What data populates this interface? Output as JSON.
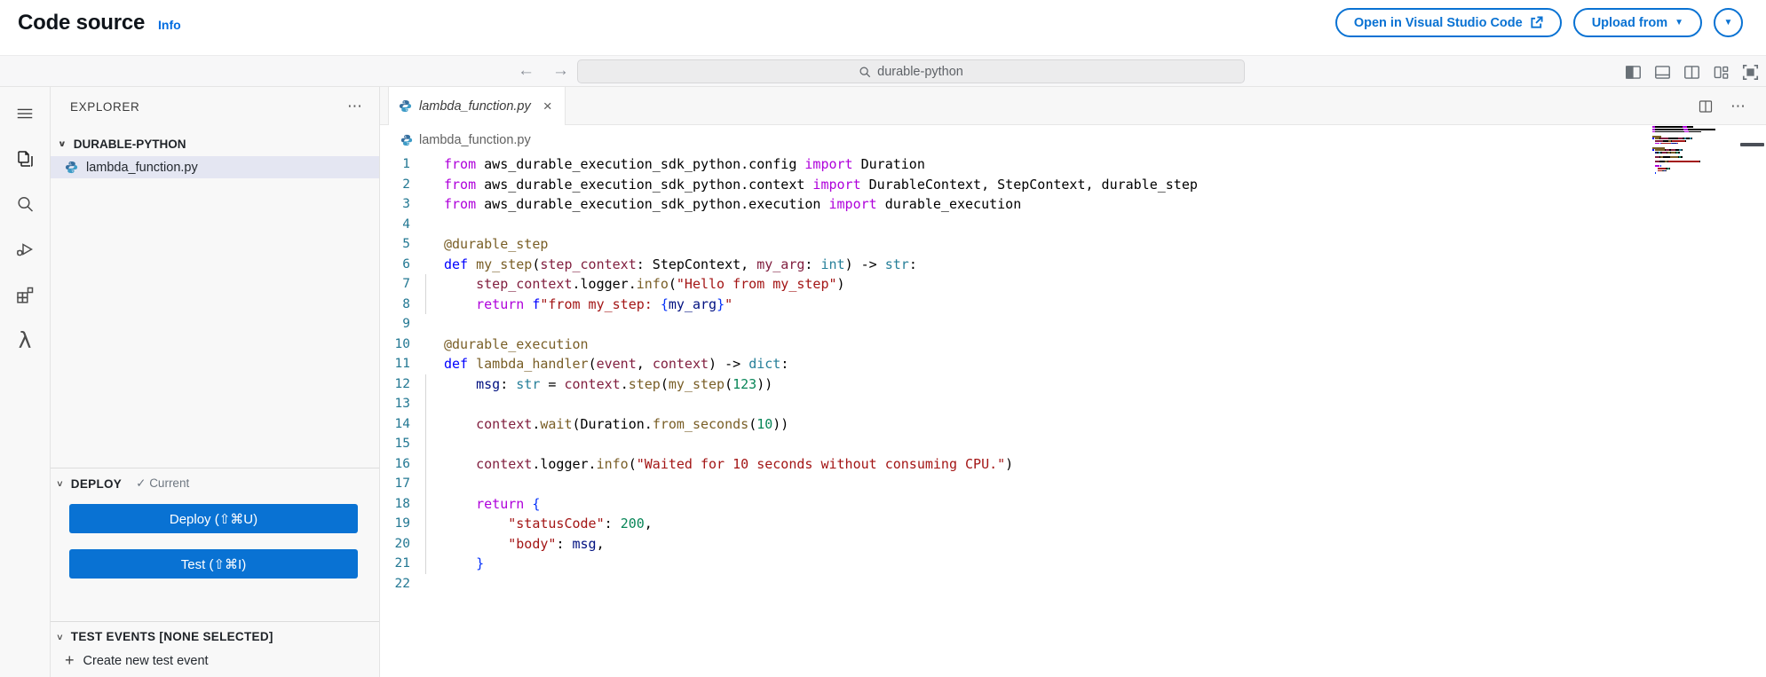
{
  "header": {
    "title": "Code source",
    "info_link": "Info",
    "open_vsc_label": "Open in Visual Studio Code",
    "upload_from_label": "Upload from"
  },
  "toolbar": {
    "search_value": "durable-python"
  },
  "icons": {
    "back": "←",
    "forward": "→",
    "more": "⋯",
    "chevron_down": "∨",
    "caret_down": "▼",
    "check": "✓",
    "plus": "+",
    "close": "×",
    "lambda": "λ"
  },
  "colors": {
    "accent_blue": "#0972d3",
    "primary_button": "#0972d3",
    "info_link": "#006ce0",
    "selection_bg": "#e4e6f2",
    "line_number": "#237893"
  },
  "explorer": {
    "title": "EXPLORER",
    "folder": "DURABLE-PYTHON",
    "file": "lambda_function.py"
  },
  "deploy": {
    "title": "DEPLOY",
    "status": "Current",
    "deploy_btn": "Deploy (⇧⌘U)",
    "test_btn": "Test (⇧⌘I)"
  },
  "test_events": {
    "title": "TEST EVENTS [NONE SELECTED]",
    "create": "Create new test event"
  },
  "editor": {
    "tab_label": "lambda_function.py",
    "breadcrumb": "lambda_function.py"
  },
  "code": {
    "colors": {
      "kw": "#0000FF",
      "kw2": "#AF00DB",
      "fn": "#795E26",
      "param": "#811F3F",
      "type": "#267F99",
      "num": "#098658",
      "str": "#A31515",
      "plain": "#000000",
      "var": "#001080",
      "brace": "#0431FA"
    },
    "lines": [
      {
        "g": 0,
        "t": [
          [
            "from",
            "kw2"
          ],
          [
            " aws_durable_execution_sdk_python.config ",
            "plain"
          ],
          [
            "import",
            "kw2"
          ],
          [
            " Duration",
            "plain"
          ]
        ]
      },
      {
        "g": 0,
        "t": [
          [
            "from",
            "kw2"
          ],
          [
            " aws_durable_execution_sdk_python.context ",
            "plain"
          ],
          [
            "import",
            "kw2"
          ],
          [
            " DurableContext, StepContext, durable_step",
            "plain"
          ]
        ]
      },
      {
        "g": 0,
        "t": [
          [
            "from",
            "kw2"
          ],
          [
            " aws_durable_execution_sdk_python.execution ",
            "plain"
          ],
          [
            "import",
            "kw2"
          ],
          [
            " durable_execution",
            "plain"
          ]
        ]
      },
      {
        "g": 0,
        "t": []
      },
      {
        "g": 0,
        "t": [
          [
            "@durable_step",
            "fn"
          ]
        ]
      },
      {
        "g": 0,
        "t": [
          [
            "def",
            "kw"
          ],
          [
            " ",
            "plain"
          ],
          [
            "my_step",
            "fn"
          ],
          [
            "(",
            "plain"
          ],
          [
            "step_context",
            "param"
          ],
          [
            ": StepContext, ",
            "plain"
          ],
          [
            "my_arg",
            "param"
          ],
          [
            ": ",
            "plain"
          ],
          [
            "int",
            "type"
          ],
          [
            ") -> ",
            "plain"
          ],
          [
            "str",
            "type"
          ],
          [
            ":",
            "plain"
          ]
        ]
      },
      {
        "g": 1,
        "t": [
          [
            "    ",
            "plain"
          ],
          [
            "step_context",
            "param"
          ],
          [
            ".logger.",
            "plain"
          ],
          [
            "info",
            "fn"
          ],
          [
            "(",
            "plain"
          ],
          [
            "\"Hello from my_step\"",
            "str"
          ],
          [
            ")",
            "plain"
          ]
        ]
      },
      {
        "g": 1,
        "t": [
          [
            "    ",
            "plain"
          ],
          [
            "return",
            "kw2"
          ],
          [
            " ",
            "plain"
          ],
          [
            "f",
            "kw"
          ],
          [
            "\"from my_step: ",
            "str"
          ],
          [
            "{",
            "brace"
          ],
          [
            "my_arg",
            "var"
          ],
          [
            "}",
            "brace"
          ],
          [
            "\"",
            "str"
          ]
        ]
      },
      {
        "g": 0,
        "t": []
      },
      {
        "g": 0,
        "t": [
          [
            "@durable_execution",
            "fn"
          ]
        ]
      },
      {
        "g": 0,
        "t": [
          [
            "def",
            "kw"
          ],
          [
            " ",
            "plain"
          ],
          [
            "lambda_handler",
            "fn"
          ],
          [
            "(",
            "plain"
          ],
          [
            "event",
            "param"
          ],
          [
            ", ",
            "plain"
          ],
          [
            "context",
            "param"
          ],
          [
            ") -> ",
            "plain"
          ],
          [
            "dict",
            "type"
          ],
          [
            ":",
            "plain"
          ]
        ]
      },
      {
        "g": 1,
        "t": [
          [
            "    ",
            "plain"
          ],
          [
            "msg",
            "var"
          ],
          [
            ": ",
            "plain"
          ],
          [
            "str",
            "type"
          ],
          [
            " = ",
            "plain"
          ],
          [
            "context",
            "param"
          ],
          [
            ".",
            "plain"
          ],
          [
            "step",
            "fn"
          ],
          [
            "(",
            "plain"
          ],
          [
            "my_step",
            "fn"
          ],
          [
            "(",
            "plain"
          ],
          [
            "123",
            "num"
          ],
          [
            "))",
            "plain"
          ]
        ]
      },
      {
        "g": 1,
        "t": []
      },
      {
        "g": 1,
        "t": [
          [
            "    ",
            "plain"
          ],
          [
            "context",
            "param"
          ],
          [
            ".",
            "plain"
          ],
          [
            "wait",
            "fn"
          ],
          [
            "(Duration.",
            "plain"
          ],
          [
            "from_seconds",
            "fn"
          ],
          [
            "(",
            "plain"
          ],
          [
            "10",
            "num"
          ],
          [
            "))",
            "plain"
          ]
        ]
      },
      {
        "g": 1,
        "t": []
      },
      {
        "g": 1,
        "t": [
          [
            "    ",
            "plain"
          ],
          [
            "context",
            "param"
          ],
          [
            ".logger.",
            "plain"
          ],
          [
            "info",
            "fn"
          ],
          [
            "(",
            "plain"
          ],
          [
            "\"Waited for 10 seconds without consuming CPU.\"",
            "str"
          ],
          [
            ")",
            "plain"
          ]
        ]
      },
      {
        "g": 1,
        "t": []
      },
      {
        "g": 1,
        "t": [
          [
            "    ",
            "plain"
          ],
          [
            "return",
            "kw2"
          ],
          [
            " ",
            "plain"
          ],
          [
            "{",
            "brace"
          ]
        ]
      },
      {
        "g": 1,
        "t": [
          [
            "        ",
            "plain"
          ],
          [
            "\"statusCode\"",
            "str"
          ],
          [
            ": ",
            "plain"
          ],
          [
            "200",
            "num"
          ],
          [
            ",",
            "plain"
          ]
        ]
      },
      {
        "g": 1,
        "t": [
          [
            "        ",
            "plain"
          ],
          [
            "\"body\"",
            "str"
          ],
          [
            ": ",
            "plain"
          ],
          [
            "msg",
            "var"
          ],
          [
            ",",
            "plain"
          ]
        ]
      },
      {
        "g": 1,
        "t": [
          [
            "    ",
            "plain"
          ],
          [
            "}",
            "brace"
          ]
        ]
      },
      {
        "g": 0,
        "t": []
      }
    ]
  }
}
